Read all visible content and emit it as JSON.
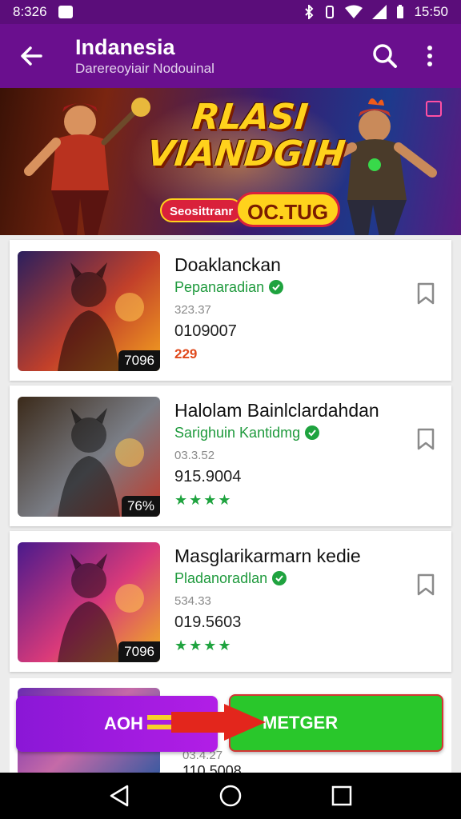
{
  "status_bar": {
    "time_left": "8:326",
    "time_right": "15:50"
  },
  "app_bar": {
    "title": "Indanesia",
    "subtitle": "Darereoyiair Nodouinal"
  },
  "banner": {
    "title_line1": "RLASI",
    "title_line2": "VIANDGIH",
    "pill": "Seosittranr",
    "badge": "OC.TUG"
  },
  "games": [
    {
      "title": "Doaklanckan",
      "developer": "Pepanaradian",
      "meta": "323.37",
      "number": "0109007",
      "footer": "229",
      "footer_type": "price",
      "percent": "7096",
      "colors": [
        "#2b1f5e",
        "#c2402a",
        "#f4a21f"
      ]
    },
    {
      "title": "Halolam Bainlclardahdan",
      "developer": "Sarighuin Kantidmg",
      "meta": "03.3.52",
      "number": "915.9004",
      "footer": "★★★★",
      "footer_type": "stars",
      "percent": "76%",
      "colors": [
        "#3b2a1a",
        "#7a7d85",
        "#c23a2a"
      ]
    },
    {
      "title": "Masglarikarmarn kedie",
      "developer": "Pladanoradlan",
      "meta": "534.33",
      "number": "019.5603",
      "footer": "★★★★",
      "footer_type": "stars",
      "percent": "7096",
      "colors": [
        "#4a1a8c",
        "#d93a7a",
        "#f0b21f"
      ]
    }
  ],
  "peek": {
    "meta": "03.4.27",
    "number": "110.5008"
  },
  "actions": {
    "left_label": "AOH",
    "right_label": "METGER"
  },
  "icons": {
    "back": "back-arrow-icon",
    "search": "search-icon",
    "more": "more-vert-icon",
    "bookmark": "bookmark-icon",
    "verified": "verified-check-icon"
  }
}
